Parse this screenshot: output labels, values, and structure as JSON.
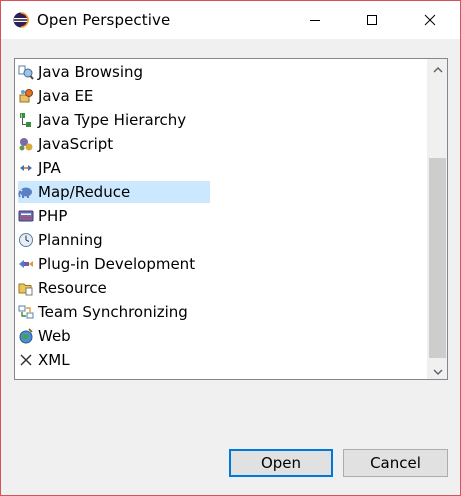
{
  "window": {
    "title": "Open Perspective",
    "title_icon": "eclipse-icon",
    "controls": {
      "minimize": "minimize-icon",
      "maximize": "maximize-icon",
      "close": "close-icon"
    }
  },
  "perspectives": [
    {
      "label": "Java Browsing",
      "icon": "java-browsing-icon",
      "selected": false
    },
    {
      "label": "Java EE",
      "icon": "java-ee-icon",
      "selected": false
    },
    {
      "label": "Java Type Hierarchy",
      "icon": "type-hierarchy-icon",
      "selected": false
    },
    {
      "label": "JavaScript",
      "icon": "javascript-icon",
      "selected": false
    },
    {
      "label": "JPA",
      "icon": "jpa-icon",
      "selected": false
    },
    {
      "label": "Map/Reduce",
      "icon": "elephant-icon",
      "selected": true
    },
    {
      "label": "PHP",
      "icon": "php-icon",
      "selected": false
    },
    {
      "label": "Planning",
      "icon": "clock-icon",
      "selected": false
    },
    {
      "label": "Plug-in Development",
      "icon": "plugin-icon",
      "selected": false
    },
    {
      "label": "Resource",
      "icon": "folder-icon",
      "selected": false
    },
    {
      "label": "Team Synchronizing",
      "icon": "sync-icon",
      "selected": false
    },
    {
      "label": "Web",
      "icon": "globe-icon",
      "selected": false
    },
    {
      "label": "XML",
      "icon": "xml-icon",
      "selected": false
    }
  ],
  "buttons": {
    "open": "Open",
    "cancel": "Cancel"
  },
  "colors": {
    "selection": "#cce8ff",
    "accent": "#0078d7",
    "border": "#d9525a"
  }
}
